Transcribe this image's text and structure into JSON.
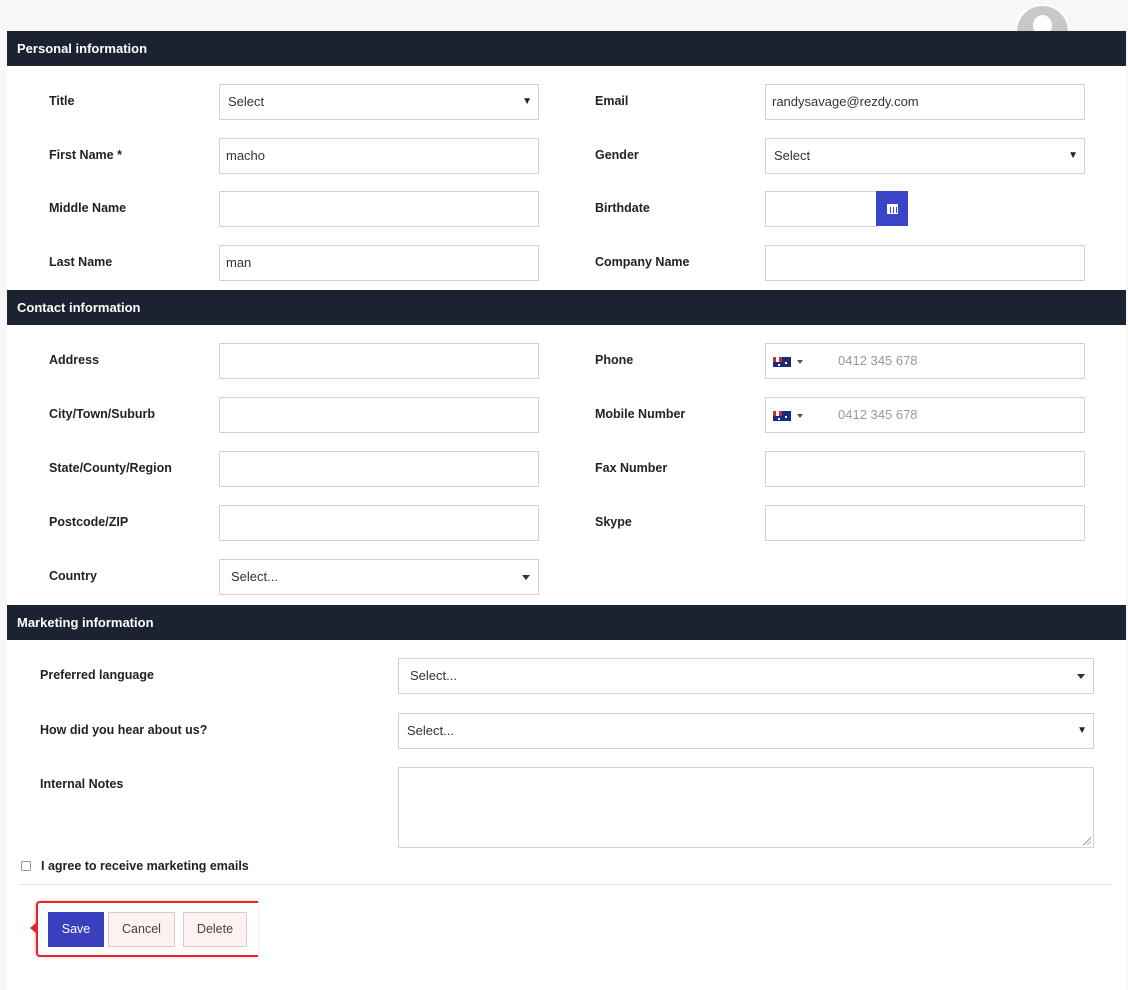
{
  "sections": {
    "personal": "Personal information",
    "contact": "Contact information",
    "marketing": "Marketing information"
  },
  "personal": {
    "title": {
      "label": "Title",
      "value": "Select"
    },
    "email": {
      "label": "Email",
      "value": "randysavage@rezdy.com"
    },
    "first_name": {
      "label": "First Name *",
      "value": "macho"
    },
    "gender": {
      "label": "Gender",
      "value": "Select"
    },
    "middle_name": {
      "label": "Middle Name",
      "value": ""
    },
    "birthdate": {
      "label": "Birthdate",
      "value": ""
    },
    "last_name": {
      "label": "Last Name",
      "value": "man"
    },
    "company_name": {
      "label": "Company Name",
      "value": ""
    }
  },
  "contact": {
    "address": {
      "label": "Address",
      "value": ""
    },
    "phone": {
      "label": "Phone",
      "placeholder": "0412 345 678"
    },
    "city": {
      "label": "City/Town/Suburb",
      "value": ""
    },
    "mobile": {
      "label": "Mobile Number",
      "placeholder": "0412 345 678"
    },
    "state": {
      "label": "State/County/Region",
      "value": ""
    },
    "fax": {
      "label": "Fax Number",
      "value": ""
    },
    "postcode": {
      "label": "Postcode/ZIP",
      "value": ""
    },
    "skype": {
      "label": "Skype",
      "value": ""
    },
    "country": {
      "label": "Country",
      "value": "Select..."
    }
  },
  "marketing": {
    "language": {
      "label": "Preferred language",
      "value": "Select..."
    },
    "heard": {
      "label": "How did you hear about us?",
      "value": "Select..."
    },
    "notes": {
      "label": "Internal Notes",
      "value": ""
    },
    "agree": {
      "label": "I agree to receive marketing emails"
    }
  },
  "actions": {
    "save": "Save",
    "cancel": "Cancel",
    "delete": "Delete"
  },
  "colors": {
    "section_bar": "#1c2330",
    "primary_button": "#3a3fc0",
    "highlight_border": "#e8212b"
  },
  "icons": {
    "avatar": "user-avatar-icon",
    "calendar": "calendar-icon",
    "flag": "australia-flag-icon"
  }
}
